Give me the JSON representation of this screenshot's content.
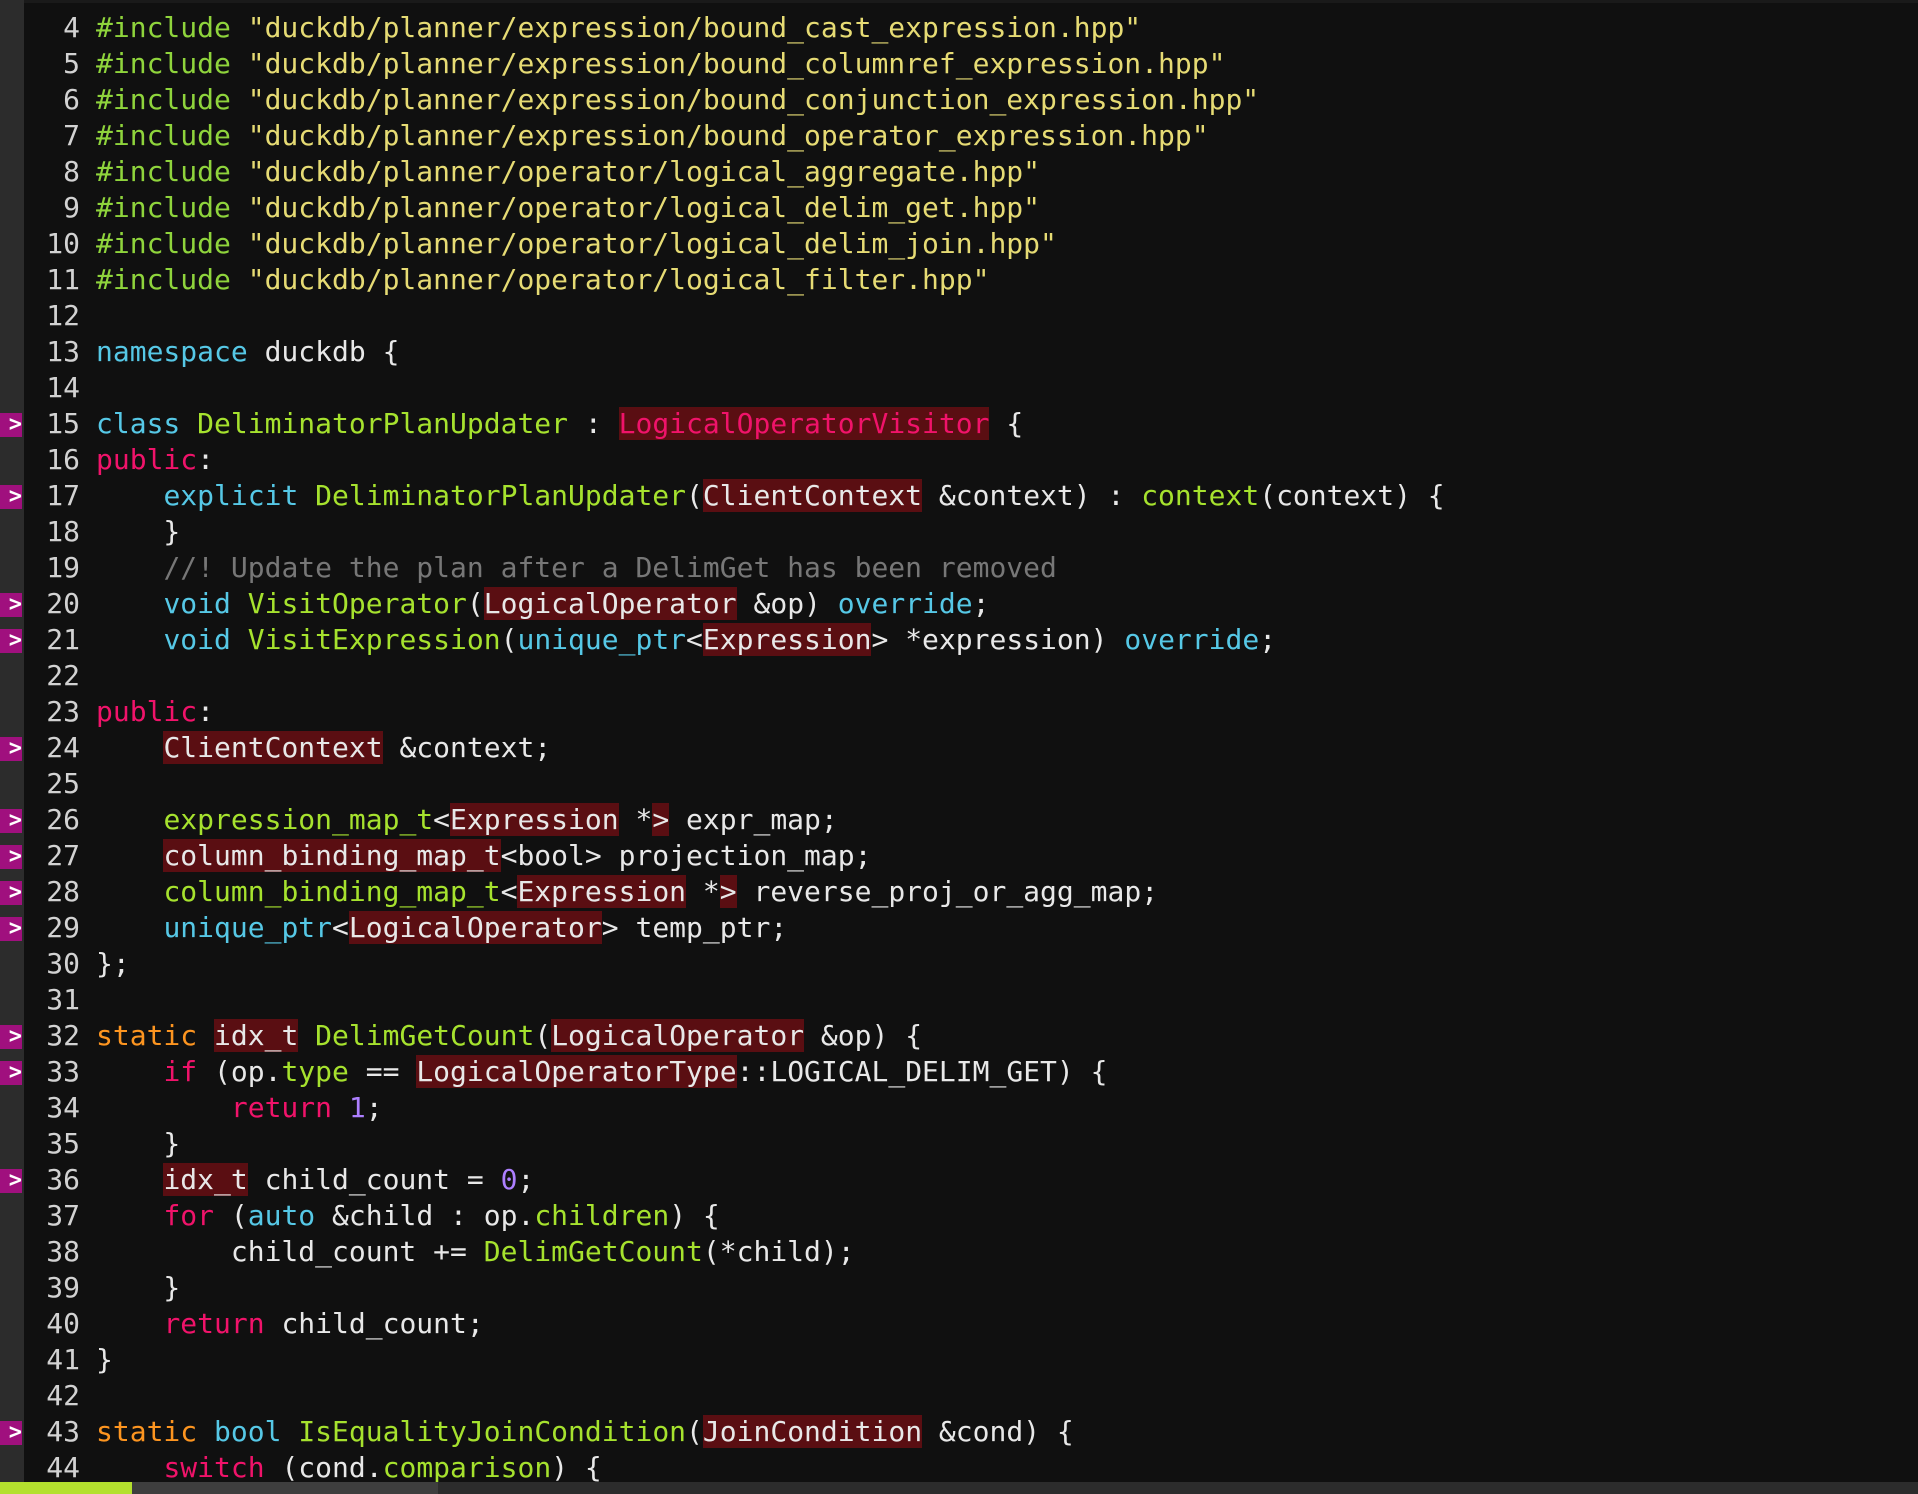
{
  "editor": {
    "sign_glyph": ">",
    "colors": {
      "background": "#101010",
      "preprocessor": "#8fd43c",
      "string": "#e6db74",
      "keyword_cyan": "#56c8e6",
      "keyword_red": "#f0136a",
      "keyword_orange": "#fd9520",
      "function": "#a6e22e",
      "number": "#ad7fff",
      "comment": "#777777",
      "highlight": "#5a0e12",
      "sign_marker": "#a0107e",
      "status_mode": "#b4e02e"
    },
    "lines": [
      {
        "n": "4",
        "sign": false,
        "segs": [
          [
            "#include",
            "kw-pp"
          ],
          [
            " ",
            ""
          ],
          [
            "\"duckdb/planner/expression/bound_cast_expression.hpp\"",
            "str"
          ]
        ]
      },
      {
        "n": "5",
        "sign": false,
        "segs": [
          [
            "#include",
            "kw-pp"
          ],
          [
            " ",
            ""
          ],
          [
            "\"duckdb/planner/expression/bound_columnref_expression.hpp\"",
            "str"
          ]
        ]
      },
      {
        "n": "6",
        "sign": false,
        "segs": [
          [
            "#include",
            "kw-pp"
          ],
          [
            " ",
            ""
          ],
          [
            "\"duckdb/planner/expression/bound_conjunction_expression.hpp\"",
            "str"
          ]
        ]
      },
      {
        "n": "7",
        "sign": false,
        "segs": [
          [
            "#include",
            "kw-pp"
          ],
          [
            " ",
            ""
          ],
          [
            "\"duckdb/planner/expression/bound_operator_expression.hpp\"",
            "str"
          ]
        ]
      },
      {
        "n": "8",
        "sign": false,
        "segs": [
          [
            "#include",
            "kw-pp"
          ],
          [
            " ",
            ""
          ],
          [
            "\"duckdb/planner/operator/logical_aggregate.hpp\"",
            "str"
          ]
        ]
      },
      {
        "n": "9",
        "sign": false,
        "segs": [
          [
            "#include",
            "kw-pp"
          ],
          [
            " ",
            ""
          ],
          [
            "\"duckdb/planner/operator/logical_delim_get.hpp\"",
            "str"
          ]
        ]
      },
      {
        "n": "10",
        "sign": false,
        "segs": [
          [
            "#include",
            "kw-pp"
          ],
          [
            " ",
            ""
          ],
          [
            "\"duckdb/planner/operator/logical_delim_join.hpp\"",
            "str"
          ]
        ]
      },
      {
        "n": "11",
        "sign": false,
        "segs": [
          [
            "#include",
            "kw-pp"
          ],
          [
            " ",
            ""
          ],
          [
            "\"duckdb/planner/operator/logical_filter.hpp\"",
            "str"
          ]
        ]
      },
      {
        "n": "12",
        "sign": false,
        "segs": []
      },
      {
        "n": "13",
        "sign": false,
        "segs": [
          [
            "namespace",
            "ns"
          ],
          [
            " duckdb {",
            ""
          ]
        ]
      },
      {
        "n": "14",
        "sign": false,
        "segs": []
      },
      {
        "n": "15",
        "sign": true,
        "segs": [
          [
            "class",
            "ns"
          ],
          [
            " ",
            ""
          ],
          [
            "DeliminatorPlanUpdater",
            "fn"
          ],
          [
            " : ",
            ""
          ],
          [
            "LogicalOperatorVisitor",
            "kw-red hl"
          ],
          [
            " {",
            ""
          ]
        ]
      },
      {
        "n": "16",
        "sign": false,
        "segs": [
          [
            "public",
            "kw-red"
          ],
          [
            ":",
            ""
          ]
        ]
      },
      {
        "n": "17",
        "sign": true,
        "segs": [
          [
            "    ",
            ""
          ],
          [
            "explicit",
            "ns"
          ],
          [
            " ",
            ""
          ],
          [
            "DeliminatorPlanUpdater",
            "fn"
          ],
          [
            "(",
            ""
          ],
          [
            "ClientContext",
            "hl"
          ],
          [
            " &context) : ",
            ""
          ],
          [
            "context",
            "fn"
          ],
          [
            "(context) {",
            ""
          ]
        ]
      },
      {
        "n": "18",
        "sign": false,
        "segs": [
          [
            "    }",
            ""
          ]
        ]
      },
      {
        "n": "19",
        "sign": false,
        "segs": [
          [
            "    ",
            ""
          ],
          [
            "//! Update the plan after a DelimGet has been removed",
            "cmt"
          ]
        ]
      },
      {
        "n": "20",
        "sign": true,
        "segs": [
          [
            "    ",
            ""
          ],
          [
            "void",
            "ns"
          ],
          [
            " ",
            ""
          ],
          [
            "VisitOperator",
            "fn"
          ],
          [
            "(",
            ""
          ],
          [
            "LogicalOperator",
            "hl"
          ],
          [
            " &op) ",
            ""
          ],
          [
            "override",
            "ns"
          ],
          [
            ";",
            ""
          ]
        ]
      },
      {
        "n": "21",
        "sign": true,
        "segs": [
          [
            "    ",
            ""
          ],
          [
            "void",
            "ns"
          ],
          [
            " ",
            ""
          ],
          [
            "VisitExpression",
            "fn"
          ],
          [
            "(",
            ""
          ],
          [
            "unique_ptr",
            "ns"
          ],
          [
            "<",
            ""
          ],
          [
            "Expression",
            "hl"
          ],
          [
            "> *expression) ",
            ""
          ],
          [
            "override",
            "ns"
          ],
          [
            ";",
            ""
          ]
        ]
      },
      {
        "n": "22",
        "sign": false,
        "segs": []
      },
      {
        "n": "23",
        "sign": false,
        "segs": [
          [
            "public",
            "kw-red"
          ],
          [
            ":",
            ""
          ]
        ]
      },
      {
        "n": "24",
        "sign": true,
        "segs": [
          [
            "    ",
            ""
          ],
          [
            "ClientContext",
            "hl"
          ],
          [
            " &context;",
            ""
          ]
        ]
      },
      {
        "n": "25",
        "sign": false,
        "segs": []
      },
      {
        "n": "26",
        "sign": true,
        "segs": [
          [
            "    ",
            ""
          ],
          [
            "expression_map_t",
            "fn"
          ],
          [
            "<",
            ""
          ],
          [
            "Expression",
            "hl"
          ],
          [
            " *",
            ""
          ],
          [
            ">",
            "hl"
          ],
          [
            " expr_map;",
            ""
          ]
        ]
      },
      {
        "n": "27",
        "sign": true,
        "segs": [
          [
            "    ",
            ""
          ],
          [
            "column_binding_map_t",
            "hl"
          ],
          [
            "<bool> projection_map;",
            ""
          ]
        ]
      },
      {
        "n": "28",
        "sign": true,
        "segs": [
          [
            "    ",
            ""
          ],
          [
            "column_binding_map_t",
            "fn"
          ],
          [
            "<",
            ""
          ],
          [
            "Expression",
            "hl"
          ],
          [
            " *",
            ""
          ],
          [
            ">",
            "hl"
          ],
          [
            " reverse_proj_or_agg_map;",
            ""
          ]
        ]
      },
      {
        "n": "29",
        "sign": true,
        "segs": [
          [
            "    ",
            ""
          ],
          [
            "unique_ptr",
            "ns"
          ],
          [
            "<",
            ""
          ],
          [
            "LogicalOperator",
            "hl"
          ],
          [
            "> temp_ptr;",
            ""
          ]
        ]
      },
      {
        "n": "30",
        "sign": false,
        "segs": [
          [
            "};",
            ""
          ]
        ]
      },
      {
        "n": "31",
        "sign": false,
        "segs": []
      },
      {
        "n": "32",
        "sign": true,
        "segs": [
          [
            "static",
            "kw-orange"
          ],
          [
            " ",
            ""
          ],
          [
            "idx_t",
            "hl"
          ],
          [
            " ",
            ""
          ],
          [
            "DelimGetCount",
            "fn"
          ],
          [
            "(",
            ""
          ],
          [
            "LogicalOperator",
            "hl"
          ],
          [
            " &op) {",
            ""
          ]
        ]
      },
      {
        "n": "33",
        "sign": true,
        "segs": [
          [
            "    ",
            ""
          ],
          [
            "if",
            "kw-red"
          ],
          [
            " (op.",
            ""
          ],
          [
            "type",
            "fn"
          ],
          [
            " == ",
            ""
          ],
          [
            "LogicalOperatorType",
            "hl"
          ],
          [
            "::LOGICAL_DELIM_GET) {",
            ""
          ]
        ]
      },
      {
        "n": "34",
        "sign": false,
        "segs": [
          [
            "        ",
            ""
          ],
          [
            "return",
            "kw-red"
          ],
          [
            " ",
            ""
          ],
          [
            "1",
            "num"
          ],
          [
            ";",
            ""
          ]
        ]
      },
      {
        "n": "35",
        "sign": false,
        "segs": [
          [
            "    }",
            ""
          ]
        ]
      },
      {
        "n": "36",
        "sign": true,
        "segs": [
          [
            "    ",
            ""
          ],
          [
            "idx_t",
            "hl"
          ],
          [
            " child_count = ",
            ""
          ],
          [
            "0",
            "num"
          ],
          [
            ";",
            ""
          ]
        ]
      },
      {
        "n": "37",
        "sign": false,
        "segs": [
          [
            "    ",
            ""
          ],
          [
            "for",
            "kw-red"
          ],
          [
            " (",
            ""
          ],
          [
            "auto",
            "ns"
          ],
          [
            " &child : op.",
            ""
          ],
          [
            "children",
            "fn"
          ],
          [
            ") {",
            ""
          ]
        ]
      },
      {
        "n": "38",
        "sign": false,
        "segs": [
          [
            "        child_count += ",
            ""
          ],
          [
            "DelimGetCount",
            "fn"
          ],
          [
            "(*child);",
            ""
          ]
        ]
      },
      {
        "n": "39",
        "sign": false,
        "segs": [
          [
            "    }",
            ""
          ]
        ]
      },
      {
        "n": "40",
        "sign": false,
        "segs": [
          [
            "    ",
            ""
          ],
          [
            "return",
            "kw-red"
          ],
          [
            " child_count;",
            ""
          ]
        ]
      },
      {
        "n": "41",
        "sign": false,
        "segs": [
          [
            "}",
            ""
          ]
        ]
      },
      {
        "n": "42",
        "sign": false,
        "segs": []
      },
      {
        "n": "43",
        "sign": true,
        "segs": [
          [
            "static",
            "kw-orange"
          ],
          [
            " ",
            ""
          ],
          [
            "bool",
            "ns"
          ],
          [
            " ",
            ""
          ],
          [
            "IsEqualityJoinCondition",
            "fn"
          ],
          [
            "(",
            ""
          ],
          [
            "JoinCondition",
            "hl"
          ],
          [
            " &cond) {",
            ""
          ]
        ]
      },
      {
        "n": "44",
        "sign": false,
        "segs": [
          [
            "    ",
            ""
          ],
          [
            "switch",
            "kw-red"
          ],
          [
            " (cond.",
            ""
          ],
          [
            "comparison",
            "fn"
          ],
          [
            ") {",
            ""
          ]
        ]
      }
    ]
  }
}
